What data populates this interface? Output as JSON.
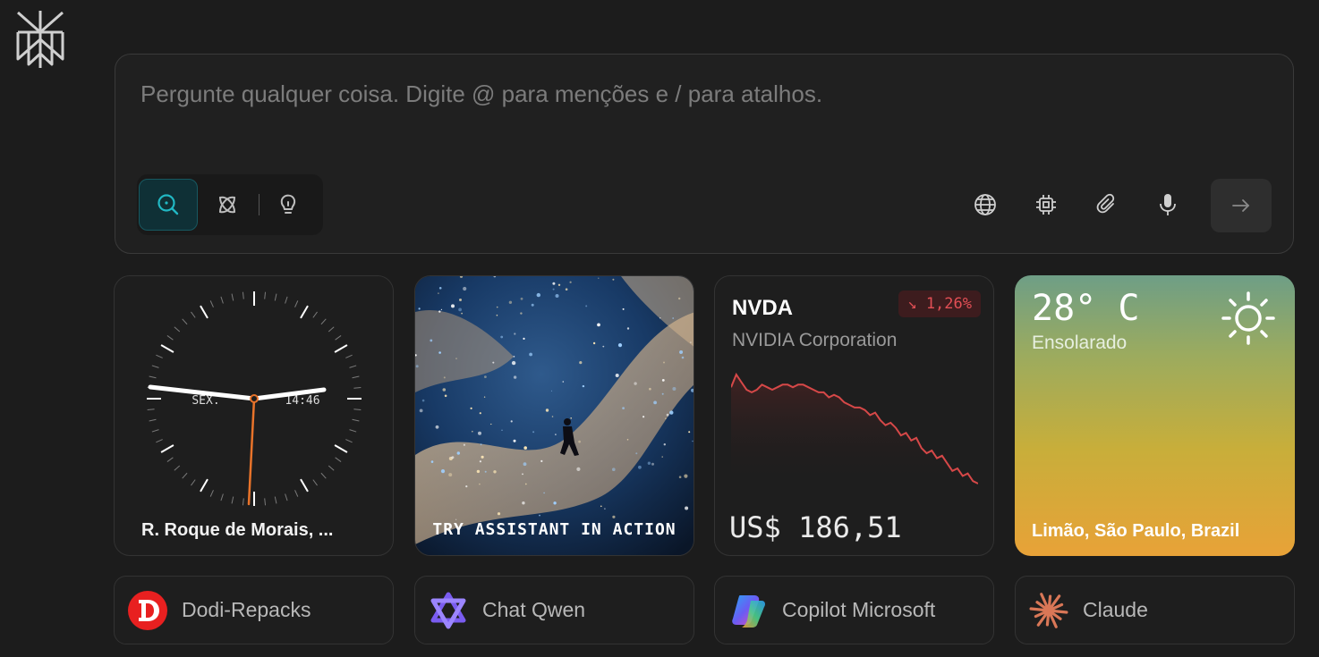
{
  "search": {
    "placeholder": "Pergunte qualquer coisa. Digite @ para menções e / para atalhos."
  },
  "search_modes": [
    "search-icon",
    "research-icon",
    "lightbulb-icon"
  ],
  "tools": [
    "globe-icon",
    "cpu-icon",
    "paperclip-icon",
    "microphone-icon",
    "arrow-right-icon"
  ],
  "clock": {
    "day": "SEX.",
    "time": "14:46",
    "location": "R. Roque de Morais, ..."
  },
  "promo": {
    "label": "TRY ASSISTANT IN ACTION"
  },
  "stock": {
    "ticker": "NVDA",
    "company": "NVIDIA Corporation",
    "change": "↘ 1,26%",
    "price": "US$ 186,51",
    "line_color": "#d64848",
    "history": [
      184,
      189,
      186,
      183,
      182,
      183,
      185,
      184,
      183,
      184,
      185,
      185,
      184,
      185,
      185,
      184,
      183,
      182,
      182,
      180,
      181,
      180,
      178,
      177,
      176,
      176,
      175,
      173,
      174,
      171,
      169,
      170,
      168,
      165,
      166,
      163,
      164,
      160,
      158,
      159,
      156,
      157,
      154,
      151,
      152,
      149,
      150,
      147,
      146
    ]
  },
  "weather": {
    "temp": "28° C",
    "condition": "Ensolarado",
    "location": "Limão, São Paulo, Brazil"
  },
  "shortcuts": [
    {
      "label": "Dodi-Repacks",
      "icon": "dodi-icon"
    },
    {
      "label": "Chat Qwen",
      "icon": "qwen-icon"
    },
    {
      "label": "Copilot Microsoft",
      "icon": "copilot-icon"
    },
    {
      "label": "Claude",
      "icon": "claude-icon"
    }
  ],
  "colors": {
    "background": "#1c1c1c",
    "accent": "#21b8c4",
    "negative": "#e24f55"
  }
}
